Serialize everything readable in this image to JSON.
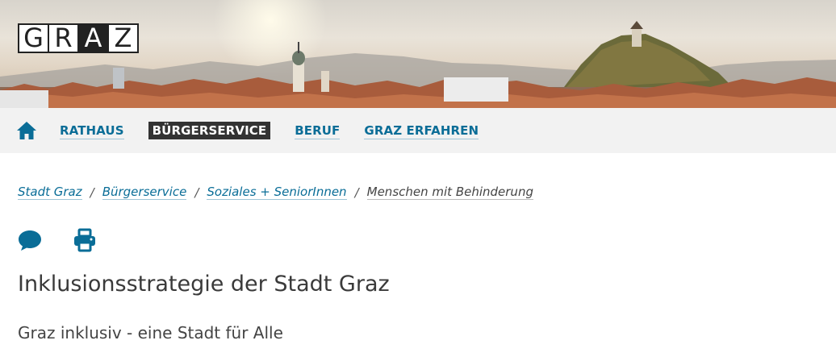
{
  "header": {
    "logo_letters": [
      "G",
      "R",
      "A",
      "Z"
    ]
  },
  "nav": {
    "home_icon": "home-icon",
    "items": [
      {
        "label": "RATHAUS",
        "active": false
      },
      {
        "label": "BÜRGERSERVICE",
        "active": true
      },
      {
        "label": "BERUF",
        "active": false
      },
      {
        "label": "GRAZ ERFAHREN",
        "active": false
      }
    ]
  },
  "breadcrumb": {
    "items": [
      {
        "label": "Stadt Graz"
      },
      {
        "label": "Bürgerservice"
      },
      {
        "label": "Soziales + SeniorInnen"
      },
      {
        "label": "Menschen mit Behinderung"
      }
    ],
    "separator": "/"
  },
  "tools": {
    "comment_icon": "speech-bubble-icon",
    "print_icon": "printer-icon"
  },
  "page": {
    "title": "Inklusionsstrategie der Stadt Graz",
    "subtitle": "Graz inklusiv - eine Stadt für Alle"
  },
  "colors": {
    "link": "#0a6d97",
    "nav_bg": "#f2f2f2",
    "active_bg": "#333333"
  }
}
